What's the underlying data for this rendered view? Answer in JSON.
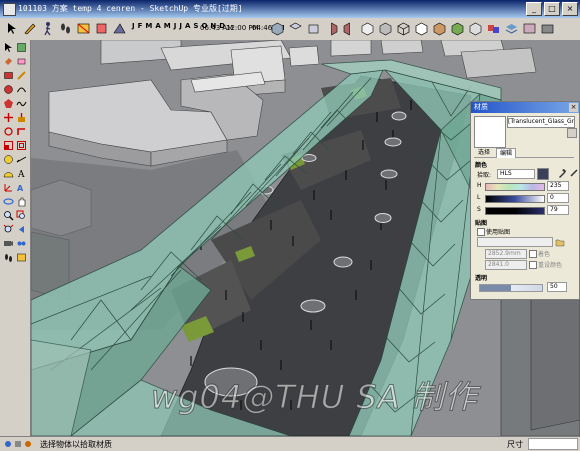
{
  "titlebar": {
    "title": "101103 方案 temp 4 cenren - SketchUp 专业版[过期]",
    "controls": [
      "_",
      "□",
      "×"
    ]
  },
  "toolbar": {
    "shadow_months": [
      "J",
      "F",
      "M",
      "A",
      "M",
      "J",
      "J",
      "A",
      "S",
      "O",
      "N",
      "D"
    ],
    "time_start": "06:43 AM",
    "time_noon": "12:00 PM",
    "time_end": "04:46 PM"
  },
  "material_panel": {
    "title": "材质",
    "close": "×",
    "material_name": "[Translucent_Glass_Gra",
    "tabs": [
      "选择",
      "编辑"
    ],
    "active_tab": "编辑",
    "color_label": "颜色",
    "picker_label": "拾取:",
    "picker_value": "HLS",
    "h_label": "H",
    "h_value": "235",
    "l_label": "L",
    "l_value": "0",
    "s_label": "S",
    "s_value": "79",
    "texture_label": "贴图",
    "use_texture_label": "使用贴图",
    "width_value": "2852.9mm",
    "height_value": "2841.0",
    "colorize_label": "着色",
    "reset_label": "重设颜色",
    "opacity_label": "透明",
    "opacity_value": "50",
    "opacity_fraction": 0.5
  },
  "watermark": "wg04@THU SA 制作",
  "status": {
    "hint": "选择物体以拾取材质",
    "measure_label": "尺寸"
  },
  "colors": {
    "title_active": "#0a246a",
    "panel_title": "#2355c8",
    "glass": "#8fc6b4",
    "plaza": "#3e3f43",
    "site": "#8d8f92"
  }
}
